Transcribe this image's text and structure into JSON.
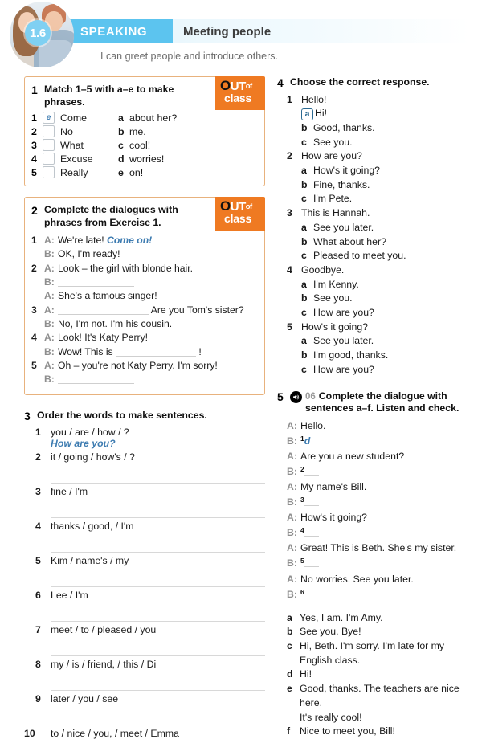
{
  "header": {
    "unit": "1.6",
    "skill": "SPEAKING",
    "topic": "Meeting people",
    "can_do": "I can greet people and introduce others.",
    "bar_color": "#5cc4ef",
    "circle_color": "#7fd0f2"
  },
  "badge": {
    "o": "O",
    "ut": "UT",
    "of": "of",
    "class": "class",
    "color": "#ef7a22"
  },
  "accent_blue": "#3e7cb1",
  "ex1": {
    "number": "1",
    "title": "Match 1–5 with a–e to make phrases.",
    "left": [
      {
        "idx": "1",
        "answer": "e",
        "text": "Come"
      },
      {
        "idx": "2",
        "answer": "",
        "text": "No"
      },
      {
        "idx": "3",
        "answer": "",
        "text": "What"
      },
      {
        "idx": "4",
        "answer": "",
        "text": "Excuse"
      },
      {
        "idx": "5",
        "answer": "",
        "text": "Really"
      }
    ],
    "right": [
      {
        "letter": "a",
        "text": "about her?"
      },
      {
        "letter": "b",
        "text": "me."
      },
      {
        "letter": "c",
        "text": "cool!"
      },
      {
        "letter": "d",
        "text": "worries!"
      },
      {
        "letter": "e",
        "text": "on!"
      }
    ]
  },
  "ex2": {
    "number": "2",
    "title": "Complete the dialogues with phrases from Exercise 1.",
    "items": [
      {
        "num": "1",
        "lines": [
          {
            "spk": "A:",
            "pre": "We're late! ",
            "answer": "Come on!",
            "blank": 0,
            "post": ""
          },
          {
            "spk": "B:",
            "pre": "OK, I'm ready!",
            "answer": "",
            "blank": 0,
            "post": ""
          }
        ]
      },
      {
        "num": "2",
        "lines": [
          {
            "spk": "A:",
            "pre": "Look – the girl with blonde hair.",
            "answer": "",
            "blank": 0,
            "post": ""
          },
          {
            "spk": "B:",
            "pre": "",
            "answer": "",
            "blank": 95,
            "post": ""
          },
          {
            "spk": "A:",
            "pre": "She's a famous singer!",
            "answer": "",
            "blank": 0,
            "post": ""
          }
        ]
      },
      {
        "num": "3",
        "lines": [
          {
            "spk": "A:",
            "pre": "",
            "answer": "",
            "blank": 120,
            "post": " Are you Tom's sister?"
          },
          {
            "spk": "B:",
            "pre": "No, I'm not. I'm his cousin.",
            "answer": "",
            "blank": 0,
            "post": ""
          }
        ]
      },
      {
        "num": "4",
        "lines": [
          {
            "spk": "A:",
            "pre": "Look! It's Katy Perry!",
            "answer": "",
            "blank": 0,
            "post": ""
          },
          {
            "spk": "B:",
            "pre": "Wow! This is ",
            "answer": "",
            "blank": 106,
            "post": " !"
          }
        ]
      },
      {
        "num": "5",
        "lines": [
          {
            "spk": "A:",
            "pre": "Oh – you're not Katy Perry. I'm sorry!",
            "answer": "",
            "blank": 0,
            "post": ""
          },
          {
            "spk": "B:",
            "pre": "",
            "answer": "",
            "blank": 95,
            "post": ""
          }
        ]
      }
    ]
  },
  "ex3": {
    "number": "3",
    "title": "Order the words to make sentences.",
    "items": [
      {
        "num": "1",
        "words": "you / are / how / ?",
        "answer": "How are you?"
      },
      {
        "num": "2",
        "words": "it / going / how's / ?",
        "answer": ""
      },
      {
        "num": "3",
        "words": "fine / I'm",
        "answer": ""
      },
      {
        "num": "4",
        "words": "thanks / good, / I'm",
        "answer": ""
      },
      {
        "num": "5",
        "words": "Kim / name's / my",
        "answer": ""
      },
      {
        "num": "6",
        "words": "Lee / I'm",
        "answer": ""
      },
      {
        "num": "7",
        "words": "meet / to / pleased / you",
        "answer": ""
      },
      {
        "num": "8",
        "words": "my / is / friend, / this / Di",
        "answer": ""
      },
      {
        "num": "9",
        "words": "later / you / see",
        "answer": ""
      },
      {
        "num": "10",
        "words": "to / nice / you, / meet / Emma",
        "answer": ""
      }
    ]
  },
  "ex4": {
    "number": "4",
    "title": "Choose the correct response.",
    "items": [
      {
        "num": "1",
        "prompt": "Hello!",
        "options": [
          {
            "letter": "a",
            "text": "Hi!",
            "selected": true
          },
          {
            "letter": "b",
            "text": "Good, thanks.",
            "selected": false
          },
          {
            "letter": "c",
            "text": "See you.",
            "selected": false
          }
        ]
      },
      {
        "num": "2",
        "prompt": "How are you?",
        "options": [
          {
            "letter": "a",
            "text": "How's it going?",
            "selected": false
          },
          {
            "letter": "b",
            "text": "Fine, thanks.",
            "selected": false
          },
          {
            "letter": "c",
            "text": "I'm Pete.",
            "selected": false
          }
        ]
      },
      {
        "num": "3",
        "prompt": "This is Hannah.",
        "options": [
          {
            "letter": "a",
            "text": "See you later.",
            "selected": false
          },
          {
            "letter": "b",
            "text": "What about her?",
            "selected": false
          },
          {
            "letter": "c",
            "text": "Pleased to meet you.",
            "selected": false
          }
        ]
      },
      {
        "num": "4",
        "prompt": "Goodbye.",
        "options": [
          {
            "letter": "a",
            "text": "I'm Kenny.",
            "selected": false
          },
          {
            "letter": "b",
            "text": "See you.",
            "selected": false
          },
          {
            "letter": "c",
            "text": "How are you?",
            "selected": false
          }
        ]
      },
      {
        "num": "5",
        "prompt": "How's it going?",
        "options": [
          {
            "letter": "a",
            "text": "See you later.",
            "selected": false
          },
          {
            "letter": "b",
            "text": "I'm good, thanks.",
            "selected": false
          },
          {
            "letter": "c",
            "text": "How are you?",
            "selected": false
          }
        ]
      }
    ]
  },
  "ex5": {
    "number": "5",
    "track": "06",
    "audio_icon": "speaker-icon",
    "title": "Complete the dialogue with sentences a–f. Listen and check.",
    "dialogue": [
      {
        "spk": "A:",
        "text": "Hello.",
        "sup": "",
        "answer": "",
        "blank": false
      },
      {
        "spk": "B:",
        "text": "",
        "sup": "1",
        "answer": "d",
        "blank": false
      },
      {
        "spk": "A:",
        "text": "Are you a new student?",
        "sup": "",
        "answer": "",
        "blank": false
      },
      {
        "spk": "B:",
        "text": "",
        "sup": "2",
        "answer": "",
        "blank": true
      },
      {
        "spk": "A:",
        "text": "My name's Bill.",
        "sup": "",
        "answer": "",
        "blank": false
      },
      {
        "spk": "B:",
        "text": "",
        "sup": "3",
        "answer": "",
        "blank": true
      },
      {
        "spk": "A:",
        "text": "How's it going?",
        "sup": "",
        "answer": "",
        "blank": false
      },
      {
        "spk": "B:",
        "text": "",
        "sup": "4",
        "answer": "",
        "blank": true
      },
      {
        "spk": "A:",
        "text": "Great! This is Beth. She's my sister.",
        "sup": "",
        "answer": "",
        "blank": false
      },
      {
        "spk": "B:",
        "text": "",
        "sup": "5",
        "answer": "",
        "blank": true
      },
      {
        "spk": "A:",
        "text": "No worries. See you later.",
        "sup": "",
        "answer": "",
        "blank": false
      },
      {
        "spk": "B:",
        "text": "",
        "sup": "6",
        "answer": "",
        "blank": true
      }
    ],
    "sentences": [
      {
        "letter": "a",
        "text": "Yes, I am. I'm Amy.",
        "cont": ""
      },
      {
        "letter": "b",
        "text": "See you. Bye!",
        "cont": ""
      },
      {
        "letter": "c",
        "text": "Hi, Beth. I'm sorry. I'm late for my",
        "cont": "English class."
      },
      {
        "letter": "d",
        "text": "Hi!",
        "cont": ""
      },
      {
        "letter": "e",
        "text": "Good, thanks. The teachers are nice here.",
        "cont": "It's really cool!"
      },
      {
        "letter": "f",
        "text": "Nice to meet you, Bill!",
        "cont": ""
      }
    ]
  }
}
